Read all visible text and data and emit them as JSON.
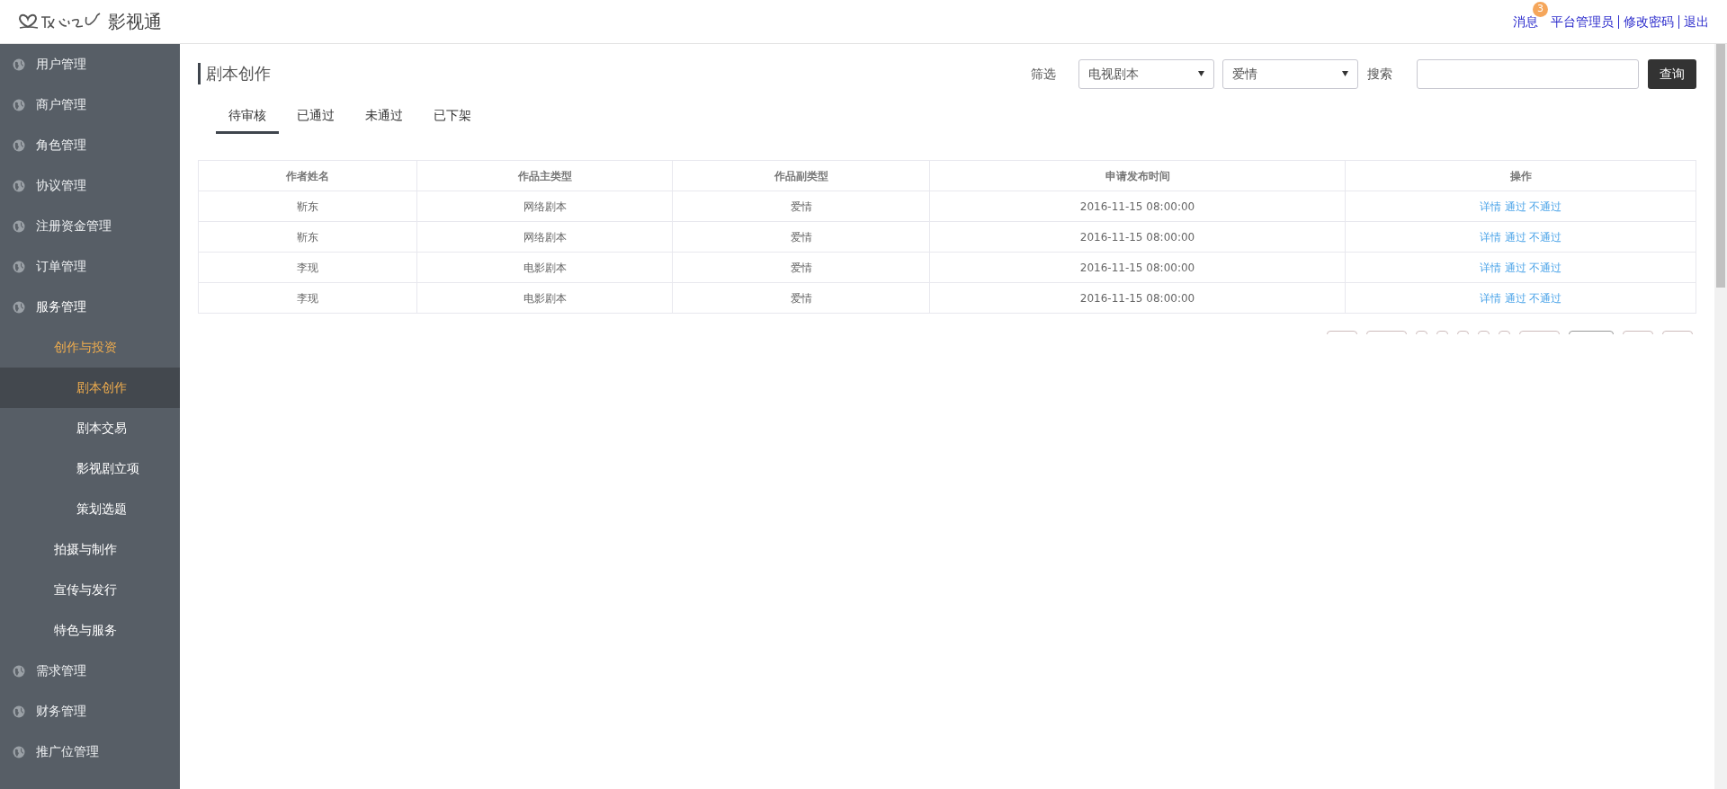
{
  "header": {
    "logo_text": "影视通",
    "messages": {
      "label": "消息",
      "badge": "3"
    },
    "links": [
      "平台管理员",
      "修改密码",
      "退出"
    ]
  },
  "sidebar": {
    "items": [
      {
        "label": "用户管理",
        "expanded": false
      },
      {
        "label": "商户管理",
        "expanded": false
      },
      {
        "label": "角色管理",
        "expanded": false
      },
      {
        "label": "协议管理",
        "expanded": false
      },
      {
        "label": "注册资金管理",
        "expanded": false
      },
      {
        "label": "订单管理",
        "expanded": false
      },
      {
        "label": "服务管理",
        "expanded": true,
        "children": [
          {
            "label": "创作与投资",
            "expanded": true,
            "children": [
              {
                "label": "剧本创作",
                "selected": true
              },
              {
                "label": "剧本交易",
                "selected": false
              },
              {
                "label": "影视剧立项",
                "selected": false
              },
              {
                "label": "策划选题",
                "selected": false
              }
            ]
          },
          {
            "label": "拍摄与制作",
            "expanded": false
          },
          {
            "label": "宣传与发行",
            "expanded": false
          },
          {
            "label": "特色与服务",
            "expanded": false
          }
        ]
      },
      {
        "label": "需求管理",
        "expanded": false
      },
      {
        "label": "财务管理",
        "expanded": false
      },
      {
        "label": "推广位管理",
        "expanded": false
      }
    ]
  },
  "page": {
    "title": "剧本创作",
    "filter_label": "筛选",
    "filter_type": "电视剧本",
    "filter_genre": "爱情",
    "search_label": "搜索",
    "query_button": "查询"
  },
  "tabs": [
    {
      "label": "待审核",
      "selected": true
    },
    {
      "label": "已通过",
      "selected": false
    },
    {
      "label": "未通过",
      "selected": false
    },
    {
      "label": "已下架",
      "selected": false
    }
  ],
  "table": {
    "columns": [
      "作者姓名",
      "作品主类型",
      "作品副类型",
      "申请发布时间",
      "操作"
    ],
    "rows": [
      {
        "cells": [
          "靳东",
          "网络剧本",
          "爱情",
          "2016-11-15 08:00:00"
        ],
        "actions": [
          "详情",
          "通过",
          "不通过"
        ]
      },
      {
        "cells": [
          "靳东",
          "网络剧本",
          "爱情",
          "2016-11-15 08:00:00"
        ],
        "actions": [
          "详情",
          "通过",
          "不通过"
        ]
      },
      {
        "cells": [
          "李现",
          "电影剧本",
          "爱情",
          "2016-11-15 08:00:00"
        ],
        "actions": [
          "详情",
          "通过",
          "不通过"
        ]
      },
      {
        "cells": [
          "李现",
          "电影剧本",
          "爱情",
          "2016-11-15 08:00:00"
        ],
        "actions": [
          "详情",
          "通过",
          "不通过"
        ]
      }
    ]
  },
  "pagination": [
    {
      "kind": "wide",
      "selected": false
    },
    {
      "kind": "wider",
      "selected": false
    },
    {
      "kind": "page",
      "selected": false
    },
    {
      "kind": "page",
      "selected": false
    },
    {
      "kind": "page",
      "selected": false
    },
    {
      "kind": "page",
      "selected": false
    },
    {
      "kind": "page",
      "selected": false
    },
    {
      "kind": "wider",
      "selected": false
    },
    {
      "kind": "widest",
      "selected": true
    },
    {
      "kind": "wide",
      "selected": false
    },
    {
      "kind": "wide",
      "selected": false
    }
  ]
}
